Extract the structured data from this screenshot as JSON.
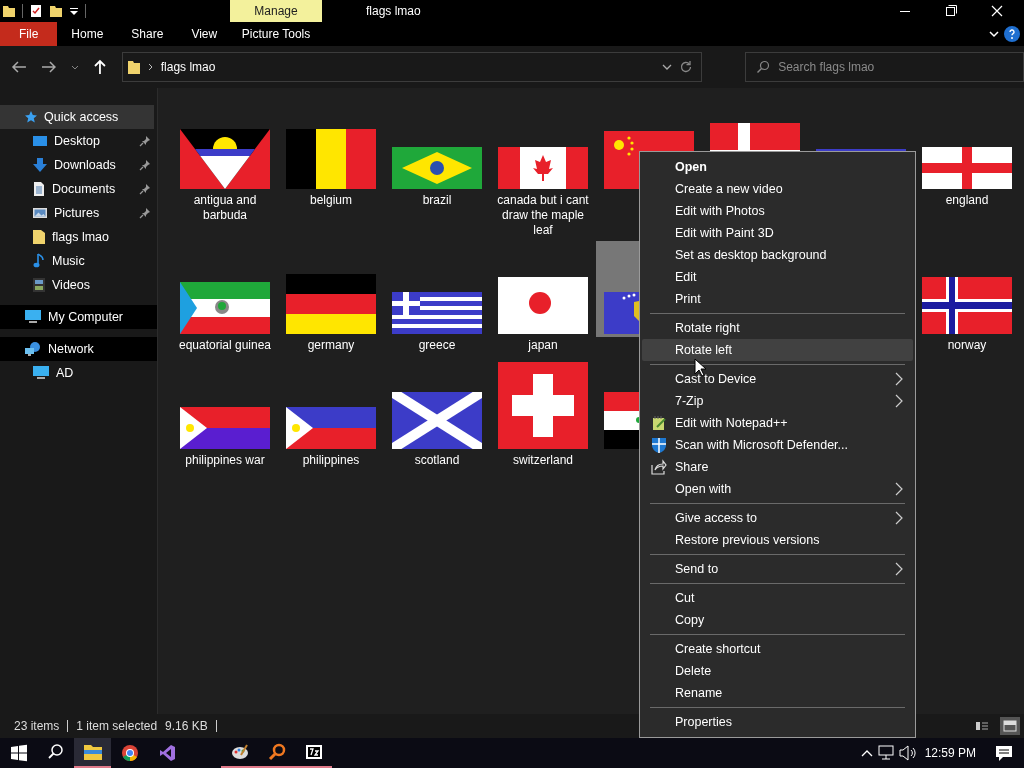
{
  "window": {
    "title": "flags lmao",
    "context_header": "Manage"
  },
  "ribbon": {
    "tabs": [
      {
        "label": "File",
        "kind": "file"
      },
      {
        "label": "Home",
        "kind": "tab"
      },
      {
        "label": "Share",
        "kind": "tab"
      },
      {
        "label": "View",
        "kind": "tab"
      }
    ],
    "context_tabs": [
      "Picture Tools"
    ]
  },
  "address_bar": {
    "path": "flags lmao"
  },
  "search": {
    "placeholder": "Search flags lmao"
  },
  "navigation": [
    {
      "label": "Quick access",
      "kind": "star",
      "selected": true,
      "children": [
        {
          "label": "Desktop",
          "kind": "desktop",
          "pinned": true,
          "selected": false
        },
        {
          "label": "Downloads",
          "kind": "download",
          "pinned": true,
          "selected": false
        },
        {
          "label": "Documents",
          "kind": "document",
          "pinned": true,
          "selected": false
        },
        {
          "label": "Pictures",
          "kind": "pictures",
          "pinned": true,
          "selected": false
        },
        {
          "label": "flags lmao",
          "kind": "folder",
          "pinned": false,
          "selected": false
        },
        {
          "label": "Music",
          "kind": "music",
          "pinned": false,
          "selected": false
        },
        {
          "label": "Videos",
          "kind": "videos",
          "pinned": false,
          "selected": false
        }
      ]
    },
    {
      "label": "My Computer",
      "kind": "computer",
      "selected": false
    },
    {
      "label": "Network",
      "kind": "network",
      "selected": false,
      "children": [
        {
          "label": "AD",
          "kind": "computer",
          "pinned": false,
          "selected": false
        }
      ]
    }
  ],
  "files": {
    "rows": [
      [
        {
          "label": "antigua and barbuda",
          "selected": false
        },
        {
          "label": "belgium",
          "selected": false
        },
        {
          "label": "brazil",
          "selected": false
        },
        {
          "label": "canada but i cant draw the maple leaf",
          "selected": false
        },
        {
          "selected": false
        },
        {
          "selected": false
        },
        {
          "selected": false
        },
        {
          "label": "england",
          "selected": false
        }
      ],
      [
        {
          "label": "equatorial guinea",
          "selected": false
        },
        {
          "label": "germany",
          "selected": false
        },
        {
          "label": "greece",
          "selected": false
        },
        {
          "label": "japan",
          "selected": false
        },
        {
          "selected": true
        },
        null,
        null,
        {
          "label": "norway",
          "selected": false
        }
      ],
      [
        {
          "label": "philippines war",
          "selected": false
        },
        {
          "label": "philippines",
          "selected": false
        },
        {
          "label": "scotland",
          "selected": false
        },
        {
          "label": "switzerland",
          "selected": false
        },
        {
          "selected": false
        }
      ]
    ]
  },
  "context_menu": {
    "groups": [
      [
        {
          "label": "Open",
          "kind": "plain",
          "default": true,
          "submenu": false,
          "highlighted": false
        },
        {
          "label": "Create a new video",
          "kind": "plain",
          "default": false,
          "submenu": false,
          "highlighted": false
        },
        {
          "label": "Edit with Photos",
          "kind": "plain",
          "default": false,
          "submenu": false,
          "highlighted": false
        },
        {
          "label": "Edit with Paint 3D",
          "kind": "plain",
          "default": false,
          "submenu": false,
          "highlighted": false
        },
        {
          "label": "Set as desktop background",
          "kind": "plain",
          "default": false,
          "submenu": false,
          "highlighted": false
        },
        {
          "label": "Edit",
          "kind": "plain",
          "default": false,
          "submenu": false,
          "highlighted": false
        },
        {
          "label": "Print",
          "kind": "plain",
          "default": false,
          "submenu": false,
          "highlighted": false
        }
      ],
      [
        {
          "label": "Rotate right",
          "kind": "plain",
          "default": false,
          "submenu": false,
          "highlighted": false
        },
        {
          "label": "Rotate left",
          "kind": "plain",
          "default": false,
          "submenu": false,
          "highlighted": true
        }
      ],
      [
        {
          "label": "Cast to Device",
          "kind": "plain",
          "default": false,
          "submenu": true,
          "highlighted": false
        },
        {
          "label": "7-Zip",
          "kind": "plain",
          "default": false,
          "submenu": true,
          "highlighted": false
        },
        {
          "label": "Edit with Notepad++",
          "kind": "notepad",
          "default": false,
          "submenu": false,
          "highlighted": false
        },
        {
          "label": "Scan with Microsoft Defender...",
          "kind": "shield",
          "default": false,
          "submenu": false,
          "highlighted": false
        },
        {
          "label": "Share",
          "kind": "share",
          "default": false,
          "submenu": false,
          "highlighted": false
        },
        {
          "label": "Open with",
          "kind": "plain",
          "default": false,
          "submenu": true,
          "highlighted": false
        }
      ],
      [
        {
          "label": "Give access to",
          "kind": "plain",
          "default": false,
          "submenu": true,
          "highlighted": false
        },
        {
          "label": "Restore previous versions",
          "kind": "plain",
          "default": false,
          "submenu": false,
          "highlighted": false
        }
      ],
      [
        {
          "label": "Send to",
          "kind": "plain",
          "default": false,
          "submenu": true,
          "highlighted": false
        }
      ],
      [
        {
          "label": "Cut",
          "kind": "plain",
          "default": false,
          "submenu": false,
          "highlighted": false
        },
        {
          "label": "Copy",
          "kind": "plain",
          "default": false,
          "submenu": false,
          "highlighted": false
        }
      ],
      [
        {
          "label": "Create shortcut",
          "kind": "plain",
          "default": false,
          "submenu": false,
          "highlighted": false
        },
        {
          "label": "Delete",
          "kind": "plain",
          "default": false,
          "submenu": false,
          "highlighted": false
        },
        {
          "label": "Rename",
          "kind": "plain",
          "default": false,
          "submenu": false,
          "highlighted": false
        }
      ],
      [
        {
          "label": "Properties",
          "kind": "plain",
          "default": false,
          "submenu": false,
          "highlighted": false
        }
      ]
    ]
  },
  "status_bar": {
    "item_count": "23 items",
    "selection": "1 item selected",
    "size": "9.16 KB",
    "views": [
      {
        "kind": "details",
        "selected": false
      },
      {
        "kind": "large",
        "selected": true
      }
    ]
  },
  "taskbar": {
    "apps": [
      {
        "kind": "explorer",
        "running": true,
        "active": true
      },
      {
        "kind": "chrome",
        "running": false,
        "active": false
      },
      {
        "kind": "studio",
        "running": false,
        "active": false
      },
      {
        "kind": "paint",
        "running": true,
        "active": false
      },
      {
        "kind": "magnifier",
        "running": true,
        "active": false
      },
      {
        "kind": "archive",
        "running": true,
        "active": false
      }
    ],
    "clock": "12:59 PM"
  }
}
